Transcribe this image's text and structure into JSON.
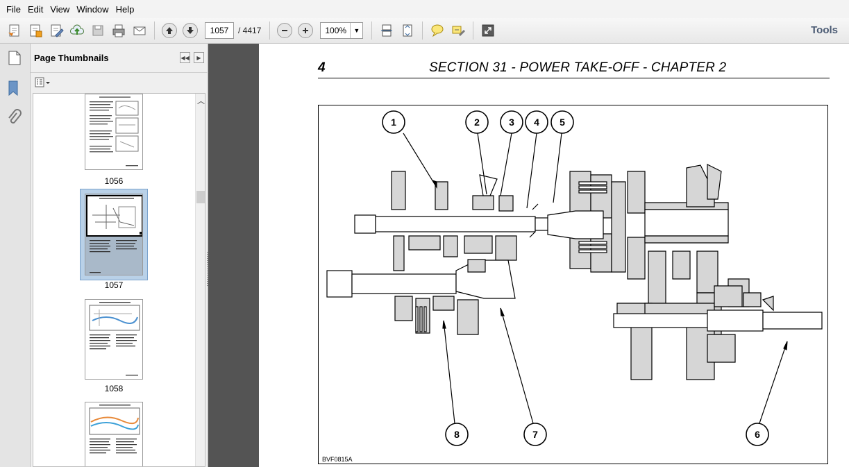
{
  "menu": [
    "File",
    "Edit",
    "View",
    "Window",
    "Help"
  ],
  "toolbar": {
    "page_current": "1057",
    "page_total": "/ 4417",
    "zoom": "100%",
    "tools_label": "Tools"
  },
  "sidebar": {
    "title": "Page Thumbnails",
    "thumbnails": [
      {
        "label": "1056",
        "selected": false
      },
      {
        "label": "1057",
        "selected": true
      },
      {
        "label": "1058",
        "selected": false
      },
      {
        "label": "",
        "selected": false
      }
    ]
  },
  "document": {
    "page_number": "4",
    "header": "SECTION 31 - POWER TAKE-OFF  -  CHAPTER  2",
    "figure_code": "BVF0815A",
    "callouts": [
      "1",
      "2",
      "3",
      "4",
      "5",
      "6",
      "7",
      "8"
    ]
  },
  "colors": {
    "gutter": "#545454",
    "selected_thumb": "#b9d1e8",
    "part_fill": "#d6d6d6"
  }
}
